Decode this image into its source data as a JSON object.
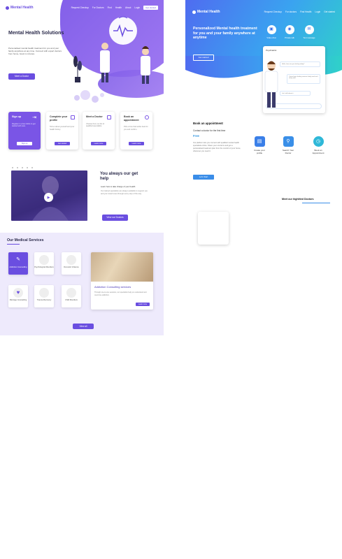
{
  "purple": {
    "logo": "Mental Health",
    "nav": {
      "links": [
        "Request Checkup",
        "For Doctors",
        "Find",
        "Health",
        "About"
      ],
      "login": "Login",
      "cta": "Get started"
    },
    "hero": {
      "title": "Mental Health Solutions",
      "subtitle": "Personalised mental health treatment for you and your family anywhere at any time. Connect with expert doctors from home, book in minutes.",
      "button": "Meet a Doctor"
    },
    "steps": [
      {
        "title": "Sign up",
        "desc": "Register in a few clicks to get started with care.",
        "button": "Sign up"
      },
      {
        "title": "Complete your profile",
        "desc": "Tell us about yourself and your health history.",
        "button": "Get started"
      },
      {
        "title": "Meet a Doctor",
        "desc": "Choose from our list of qualified specialists.",
        "button": "Learn more"
      },
      {
        "title": "Book an appointment",
        "desc": "Pick a time that works best for you and confirm.",
        "button": "Learn more"
      }
    ],
    "help": {
      "title": "You always our get help",
      "subtitle": "Learn how to take charge of your health",
      "text": "Our trained specialists are always available to support you and your loved ones through every step of the way.",
      "button": "View our Doctors"
    },
    "services": {
      "title": "Our Medical Services",
      "tiles": [
        {
          "label": "Addiction Counselling",
          "icon": "chat-icon"
        },
        {
          "label": "Psychological Disorders",
          "icon": ""
        },
        {
          "label": "Domestic Violence",
          "icon": ""
        },
        {
          "label": "Marriage Counselling",
          "icon": "heart-icon"
        },
        {
          "label": "Trauma Recovery",
          "icon": ""
        },
        {
          "label": "Child Disorders",
          "icon": ""
        }
      ],
      "card": {
        "title": "Addiction Consulting services",
        "desc": "Through one-to-one sessions, our specialists help you understand and overcome addiction.",
        "button": "Learn more"
      },
      "view_all": "View all"
    }
  },
  "blue": {
    "logo": "Mental Health",
    "nav": {
      "links": [
        "Request Checkup",
        "For doctors",
        "Find Health",
        "Login"
      ],
      "cta": "Get started"
    },
    "hero": {
      "title": "Personalized Mental health treatment for you and your family anywhere at anytime",
      "button": "Get started"
    },
    "features": [
      {
        "label": "Video chat",
        "icon": "video-icon"
      },
      {
        "label": "Private talk",
        "icon": "chat-icon"
      },
      {
        "label": "Text message",
        "icon": "message-icon"
      }
    ],
    "chat": {
      "header": "Psychiatrist",
      "messages": [
        "Hello, how are you feeling today?",
        "I have been feeling anxious lately and can't sleep well.",
        "Let's talk about it"
      ]
    },
    "appointment": {
      "title": "Book an appointment",
      "subtitle": "Contact a doctor for the first time",
      "free": "Free",
      "text": "Our platform lets you connect with qualified mental health specialists online. Share your concerns and get a personalised treatment plan from the comfort of your home, whenever you need it.",
      "button": "Let's Start",
      "steps": [
        {
          "label": "Create your profile",
          "icon": "profile-icon",
          "color": "#3a7fe8"
        },
        {
          "label": "Search Your Doctor",
          "icon": "search-icon",
          "color": "#3a8fe8"
        },
        {
          "label": "Book an Appointment",
          "icon": "clock-icon",
          "color": "#2fb8d8"
        }
      ]
    },
    "doctors": {
      "title": "Meet our highlited Doctors"
    }
  },
  "colors": {
    "purple": "#6a4ee0",
    "blue": "#3a8de8",
    "teal": "#2fd1c9"
  }
}
